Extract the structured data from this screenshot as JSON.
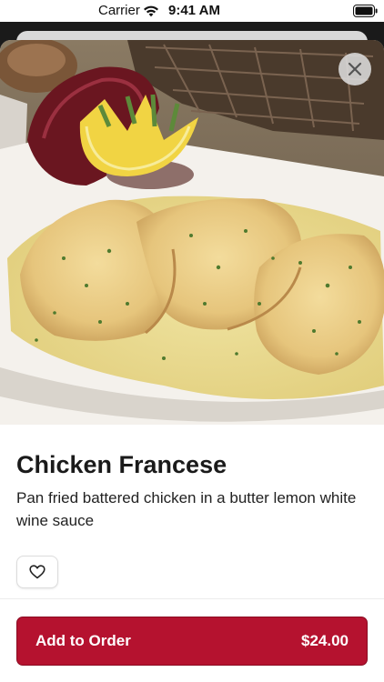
{
  "status_bar": {
    "carrier": "Carrier",
    "time": "9:41 AM"
  },
  "item": {
    "name": "Chicken Francese",
    "description": "Pan fried battered chicken in a butter lemon white wine sauce",
    "price": "$24.00"
  },
  "actions": {
    "add_label": "Add to Order"
  },
  "icons": {
    "close": "close-icon",
    "favorite": "heart-outline-icon",
    "wifi": "wifi-icon",
    "battery": "battery-icon"
  },
  "colors": {
    "accent": "#b5122f",
    "title": "#1a1a1a"
  }
}
